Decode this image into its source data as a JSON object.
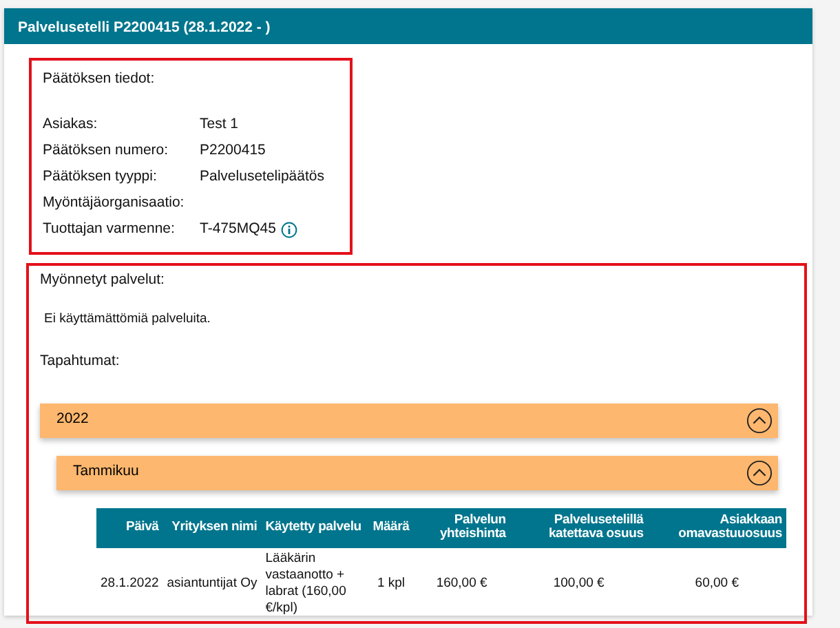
{
  "card": {
    "title": "Palvelusetelli P2200415 (28.1.2022 - )"
  },
  "decision": {
    "highlighted": true,
    "heading": "Päätöksen tiedot:",
    "fields": [
      {
        "label": "Asiakas:",
        "value": "Test 1",
        "info": false
      },
      {
        "label": "Päätöksen numero:",
        "value": "P2200415",
        "info": false
      },
      {
        "label": "Päätöksen tyyppi:",
        "value": "Palvelusetelipäätös",
        "info": false
      },
      {
        "label": "Myöntäjäorganisaatio:",
        "info": false
      },
      {
        "label": "Tuottajan varmenne:",
        "value": "T-475MQ45",
        "info": true
      }
    ]
  },
  "services": {
    "highlighted": true,
    "heading": "Myönnetyt palvelut:",
    "message": "Ei käyttämättömiä palveluita.",
    "events_heading": "Tapahtumat:",
    "year": {
      "label": "2022",
      "expanded": true
    },
    "month": {
      "label": "Tammikuu",
      "expanded": true
    },
    "table": {
      "columns": [
        "Päivä",
        "Yrityksen nimi",
        "Käytetty palvelu",
        "Määrä",
        "Palvelun yhteishinta",
        "Palvelusetelillä katettava osuus",
        "Asiakkaan omavastuuosuus"
      ],
      "rows": [
        [
          "28.1.2022",
          "asiantuntijat Oy",
          "Lääkärin vastaanotto + labrat (160,00 €/kpl)",
          "1 kpl",
          "160,00 €",
          "100,00 €",
          "60,00 €"
        ]
      ]
    }
  }
}
